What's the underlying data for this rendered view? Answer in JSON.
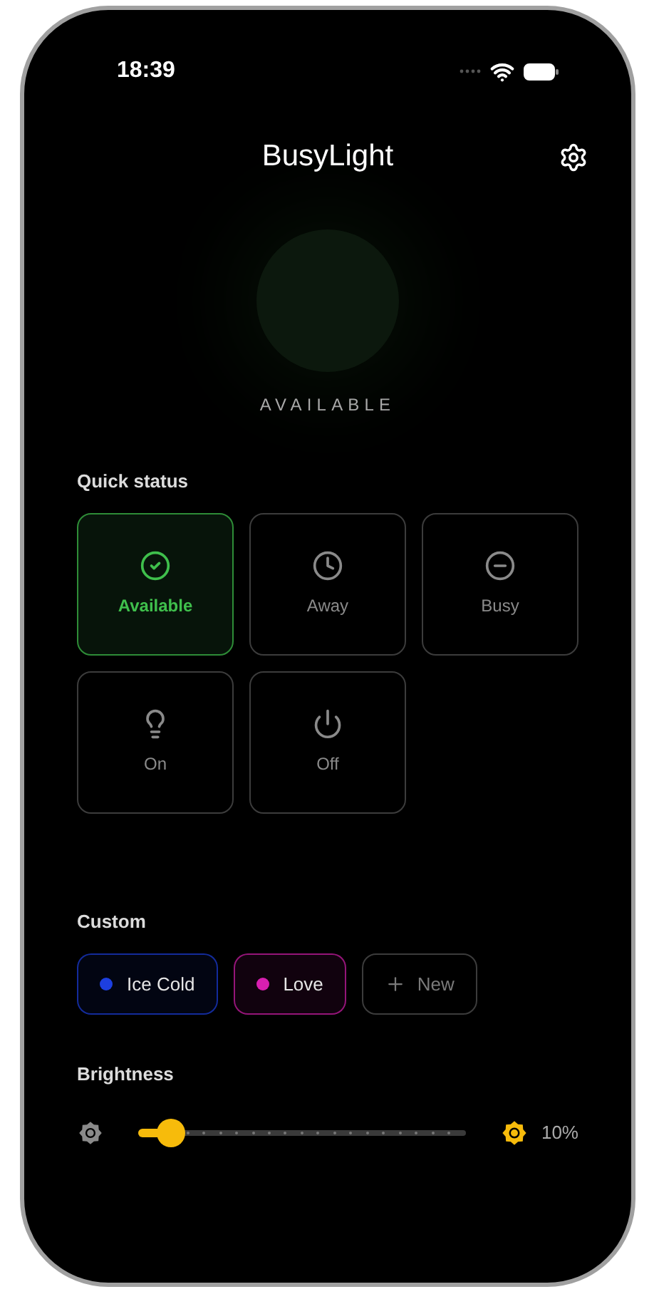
{
  "status_bar": {
    "time": "18:39"
  },
  "header": {
    "title": "BusyLight"
  },
  "light": {
    "status_label": "AVAILABLE"
  },
  "quick_status": {
    "heading": "Quick status",
    "items": [
      {
        "label": "Available",
        "selected": true
      },
      {
        "label": "Away",
        "selected": false
      },
      {
        "label": "Busy",
        "selected": false
      },
      {
        "label": "On",
        "selected": false
      },
      {
        "label": "Off",
        "selected": false
      }
    ]
  },
  "custom": {
    "heading": "Custom",
    "items": [
      {
        "label": "Ice Cold",
        "color": "#1d3fe0"
      },
      {
        "label": "Love",
        "color": "#d81fb0"
      }
    ],
    "new_button": {
      "label": "New"
    }
  },
  "brightness": {
    "heading": "Brightness",
    "level": 0.1,
    "reading": "10%"
  }
}
